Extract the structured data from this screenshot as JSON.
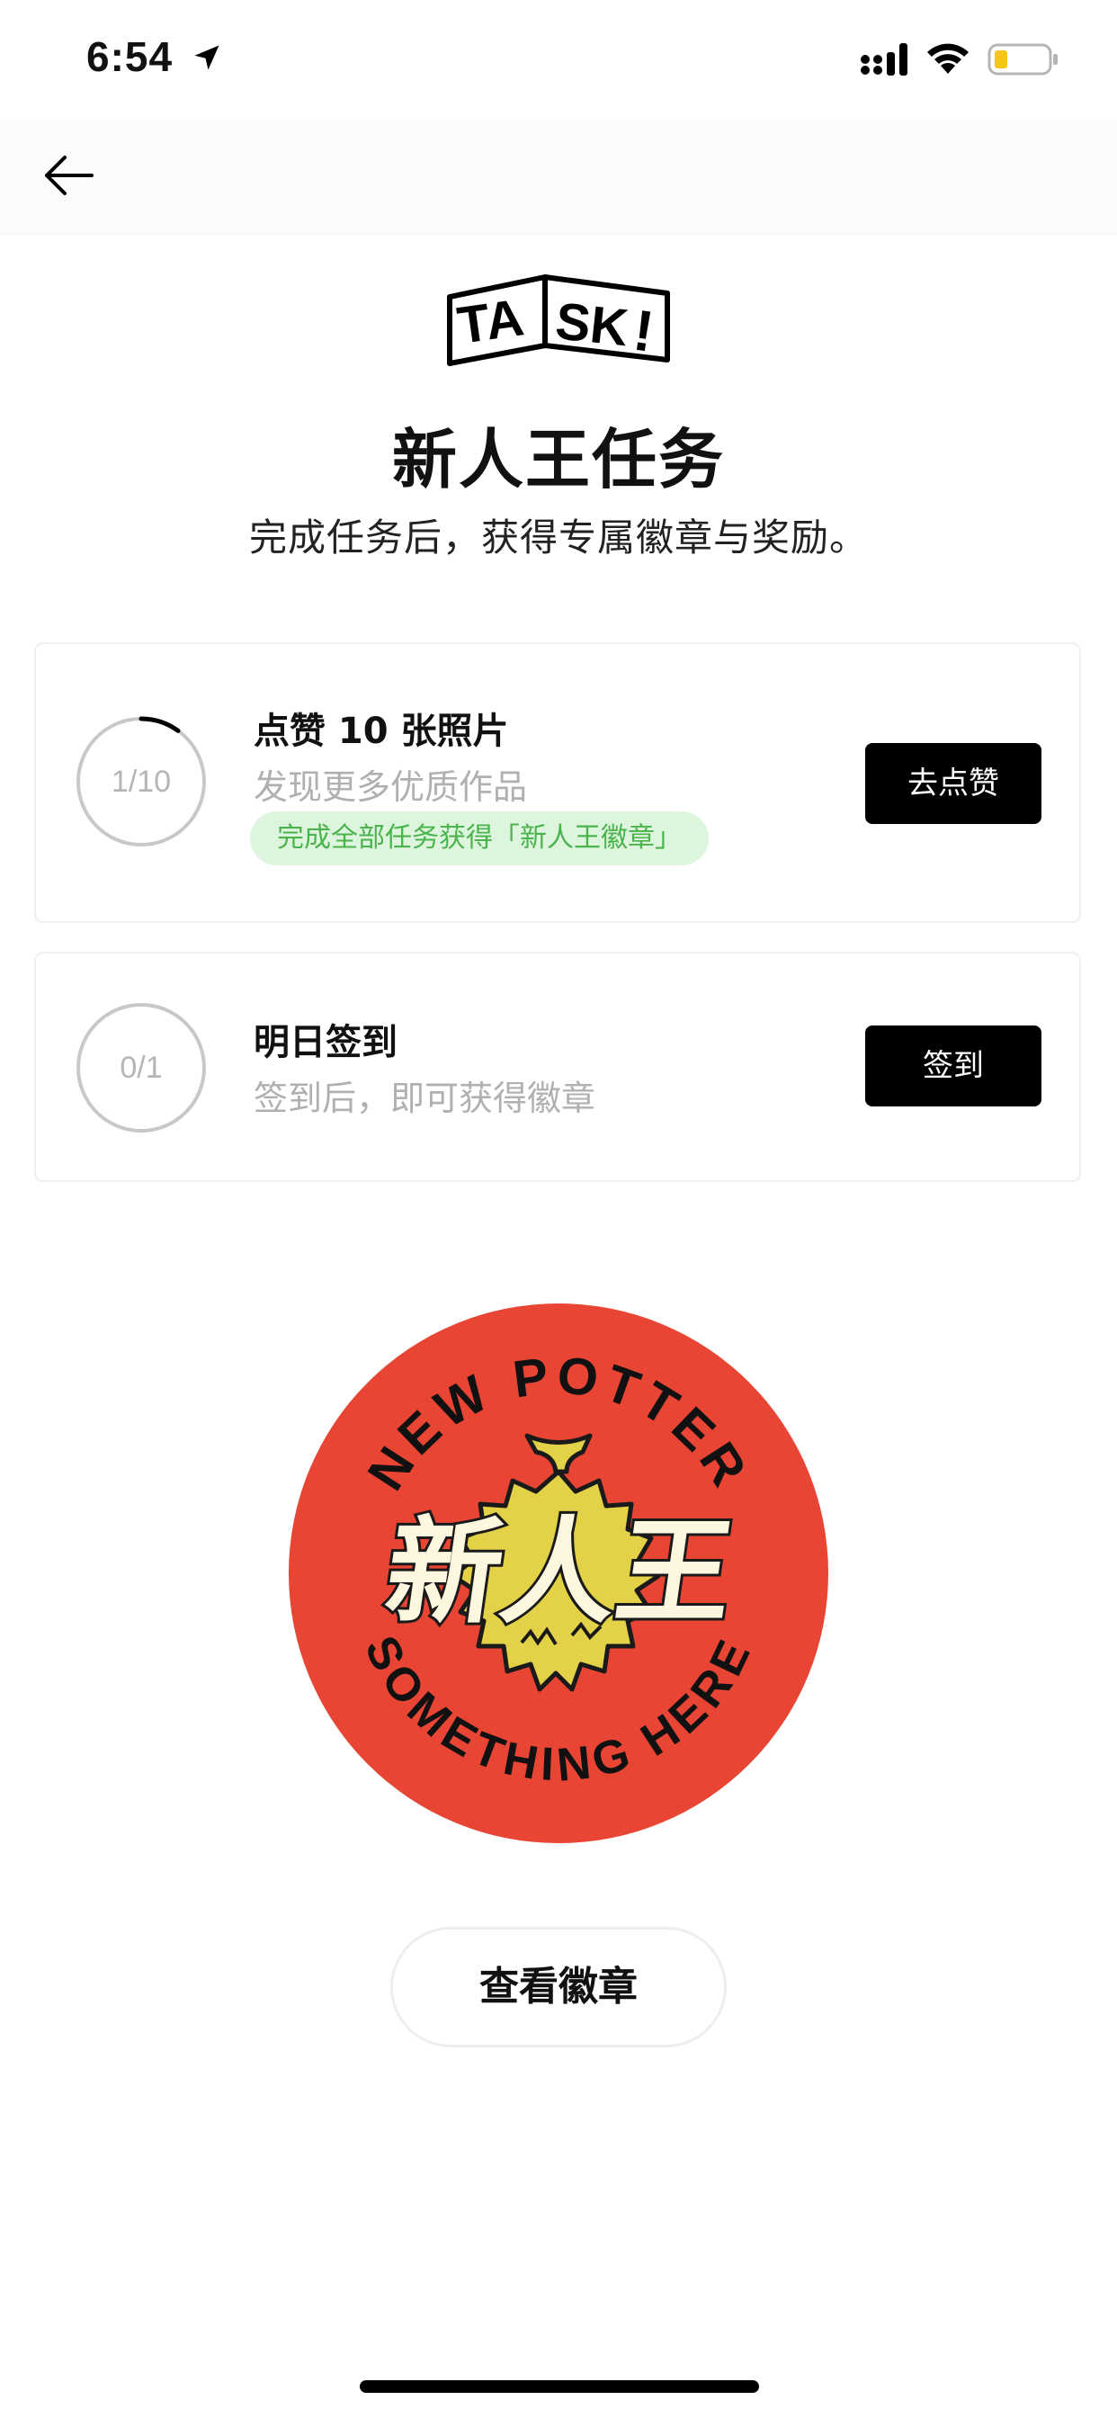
{
  "status_bar": {
    "time": "6:54",
    "icons": [
      "location-arrow-icon",
      "cellular-signal-icon",
      "wifi-icon",
      "battery-icon"
    ],
    "battery_color": "#f5c518"
  },
  "nav": {
    "back_icon": "back-arrow-icon"
  },
  "header": {
    "logo_text": "TASK!",
    "title": "新人王任务",
    "subtitle": "完成任务后，获得专属徽章与奖励。"
  },
  "tasks": [
    {
      "progress_text": "1/10",
      "progress_fraction": 0.1,
      "title": "点赞 10 张照片",
      "description": "发现更多优质作品",
      "reward_tag": "完成全部任务获得「新人王徽章」",
      "button_label": "去点赞"
    },
    {
      "progress_text": "0/1",
      "progress_fraction": 0,
      "title": "明日签到",
      "description": "签到后，即可获得徽章",
      "button_label": "签到"
    }
  ],
  "badge": {
    "top_text": "NEW POTTER",
    "center_text": "新人王",
    "bottom_text": "SOMETHING HERE",
    "colors": {
      "background": "#e84534",
      "durian": "#e3d148",
      "lettering": "#fdf7e0",
      "outline": "#1a1a1a"
    }
  },
  "view_badge_button": {
    "label": "查看徽章"
  },
  "colors": {
    "reward_tag_bg": "#ddf5dd",
    "reward_tag_text": "#4bb34d",
    "button_bg": "#000000",
    "muted_text": "#b0b0b0"
  }
}
